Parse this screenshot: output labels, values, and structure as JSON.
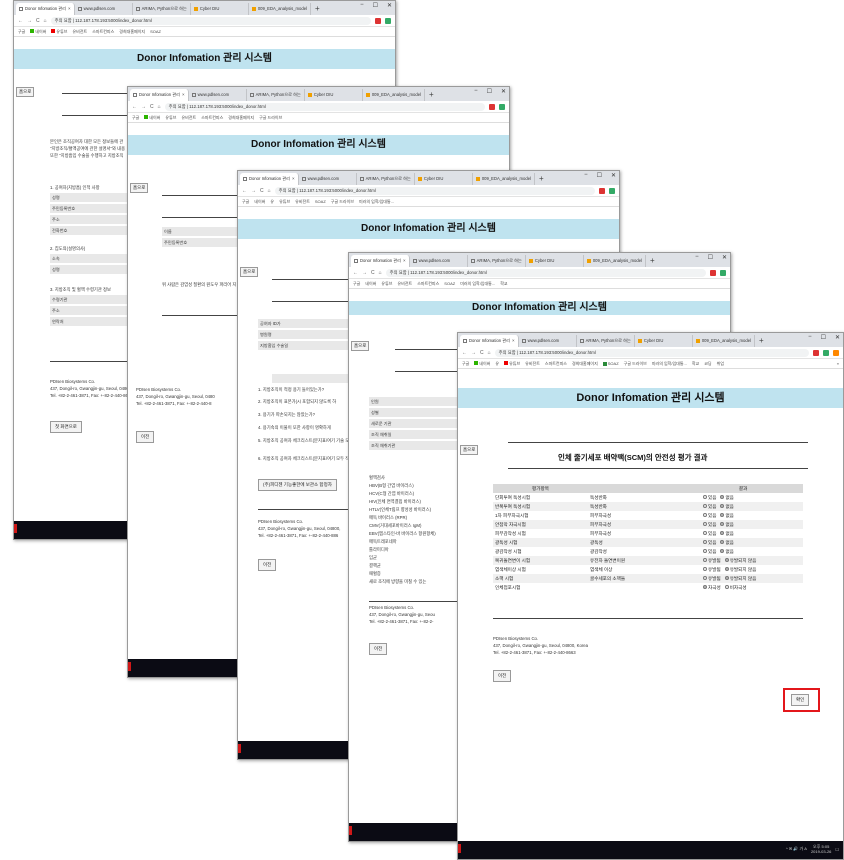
{
  "browser": {
    "tabs": [
      "Donor Infomation 관리",
      "www.pdlsen.com",
      "ARIMA, Python으로 하는",
      "Cyber DIU",
      "009_EDA_analysis_model"
    ],
    "new_tab": "+",
    "window_controls": [
      "−",
      "☐",
      "✕"
    ],
    "address": "주의 요함 | 112.187.178.193:5000/index_donor.html",
    "nav": [
      "←",
      "→",
      "C",
      "⌂"
    ],
    "bookmarks": [
      "구글",
      "네이버",
      "유",
      "유튜브",
      "유비전트",
      "스마트컨피스",
      "경희대홈페이지",
      "SOAZ",
      "구글 드라이브",
      "미러의 입학/입대통...",
      "학교",
      "코딩",
      "취업"
    ],
    "more": "»"
  },
  "site": {
    "title": "Donor Infomation 관리 시스템",
    "home_button": "홈으로"
  },
  "win1": {
    "intro": [
      "본인은 조직공여자 대한 모든 정보들에 관",
      "\"지방조직/혈액공여에 관한 설명서\"와 내용",
      "또한 \"지방흡입 수술을 수행하고 지방조직"
    ],
    "sec1": "1. 공여자(지방흡) 인적 사항",
    "sec1_rows": [
      "성명",
      "주민등록번호",
      "주소",
      "전화번호"
    ],
    "sec2": "2. 집도의(설명의사)",
    "sec2_rows": [
      "소속",
      "성명"
    ],
    "sec3": "3. 지방조직 및 혈액 수령기관 정보",
    "sec3_rows": [
      "수령기관",
      "주소",
      "연락처"
    ],
    "footer": [
      "PDIsen Biosystems Co.",
      "437, Dongil-ro, Gwangjin-gu, Seoul, 04800,",
      "Tel. +82-2-461-3871, Fax: +-82-2-440-86"
    ],
    "button": "첫 화면으로"
  },
  "win2": {
    "rows": [
      "이름",
      "주민등록번호"
    ],
    "note": "위 사람은 감염성 질환의 원도우 파리어 지",
    "footer": [
      "PDIsen Biosystems Co.",
      "437, Dongil-ro, Gwangjin-gu, Seoul, 0480",
      "Tel. +82-2-461-3871, Fax: +-82-2-440-8"
    ],
    "button": "이전"
  },
  "win3": {
    "rows": [
      "공여자 ID가",
      "병원명",
      "지방흡입 수술일"
    ],
    "check_header": "항목",
    "questions": [
      "1. 지방조직이 적정 용기 들어있는가?",
      "2. 지방조직이 표본가(시 포함되지 않도록 하",
      "3. 용기가 파손되지는 않았는가?",
      "4. 용기속의 이물이 또한 사항이 명확하게",
      "5. 지방조직 공여자 체크리스트(분지표/여기 기술 모두 작성되어 있는가?",
      "6. 지방조직 공여자 체크리스트(분지표/여기 모두 작성되는가?"
    ],
    "save_button": "(주)피디젠 기능좋한에 보관소 합정자",
    "footer": [
      "PDIsen Biosystems Co.",
      "437, Dongil-ro, Gwangjin-gu, Seoul, 04800,",
      "Tel. +82-2-461-3871, Fax: +-82-2-440-886"
    ],
    "button": "이전"
  },
  "win4": {
    "rows": [
      "인원",
      "성별",
      "새로운 기관",
      "조직 채취일",
      "조직 채취기관"
    ],
    "items": [
      "혈액검사",
      "HBV(B형 간염 바이러스)",
      "HCV(C형 간염 바이러스)",
      "HIV(인체 면역결핍 바이러스)",
      "HTLV(인체T림프 향성성 바이러스)",
      "매독 바이러스 (RPR)",
      "CMV(거대세포바이러스 IgM)",
      "EBV(엡스타인-바 바이러스 항원항체)",
      "매독트레포네마",
      "틀라미디아",
      "임균",
      "결핵균",
      "패혈증",
      "새로 조직에 방향을 미칠 수 있는"
    ],
    "footer": [
      "PDIsen Biosystems Co.",
      "437, Dongil-ro, Gwangjin-gu, Seou",
      "Tel. +82-2-461-3871, Fax: +-82-2-"
    ],
    "button": "이전"
  },
  "win5": {
    "title": "인체 줄기세포 배약팩(SCM)의 안전성 평가 결과",
    "columns": [
      "평가항목",
      "",
      "결과"
    ],
    "rows": [
      {
        "item": "단회투여 독성시험",
        "method": "독성반화",
        "r1": "있음",
        "r2": "없음",
        "sel": 2
      },
      {
        "item": "반복투여 독성시험",
        "method": "독성반화",
        "r1": "있음",
        "r2": "없음",
        "sel": 2
      },
      {
        "item": "1차 피부자극시험",
        "method": "피부자극성",
        "r1": "있음",
        "r2": "없음",
        "sel": 2
      },
      {
        "item": "안점막 자극시험",
        "method": "피부자극성",
        "r1": "있음",
        "r2": "없음",
        "sel": 2
      },
      {
        "item": "피부감작성 시험",
        "method": "피부자극성",
        "r1": "있음",
        "r2": "없음",
        "sel": 2
      },
      {
        "item": "광독성 시험",
        "method": "광독성",
        "r1": "있음",
        "r2": "없음",
        "sel": 2
      },
      {
        "item": "광감작성 시험",
        "method": "광감작성",
        "r1": "있음",
        "r2": "없음",
        "sel": 2
      },
      {
        "item": "복귀돌연변이 시험",
        "method": "유전자 돌연변이원",
        "r1": "유발됨",
        "r2": "유발되지 않음",
        "sel": 2
      },
      {
        "item": "염색체이상 시험",
        "method": "염색체 이상",
        "r1": "유발됨",
        "r2": "유발되지 않음",
        "sel": 2
      },
      {
        "item": "소핵 시험",
        "method": "골수세포의 소핵들",
        "r1": "유발됨",
        "r2": "유발되지 않음",
        "sel": 2
      },
      {
        "item": "인체첩포시험",
        "method": "",
        "r1": "자극성",
        "r2": "비자극성",
        "sel": 1
      }
    ],
    "footer": [
      "PDIsen Biosystems Co.",
      "437, Dongil-ro, Gwangjin-gu, Seoul, 04800, Korea",
      "Tel. +82-2-461-3871, Fax: +-82-2-440-8663"
    ],
    "prev_button": "이전",
    "confirm_button": "확인",
    "clock": [
      "오후 5:05",
      "2019-03-26"
    ],
    "tray": "^ ✉ 🔊 가 A"
  }
}
